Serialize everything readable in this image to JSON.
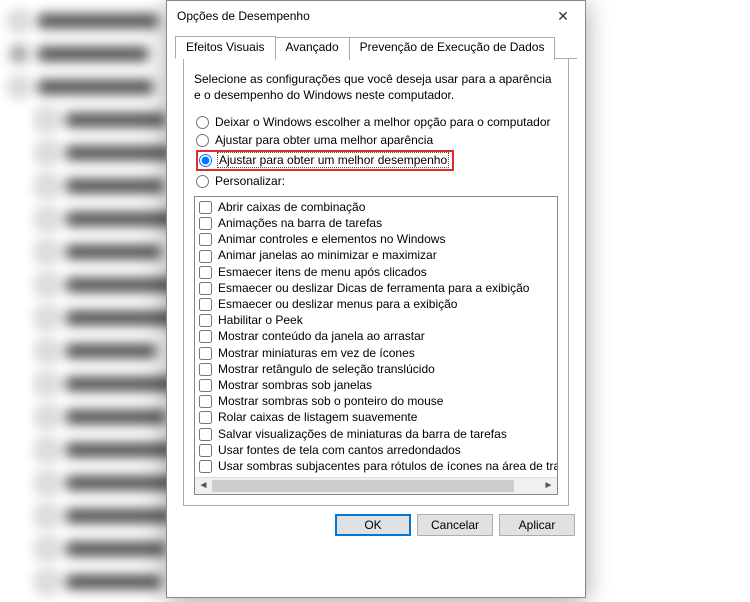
{
  "bg_rows": [
    {
      "kind": "radio",
      "sel": false,
      "w": 120
    },
    {
      "kind": "radio",
      "sel": true,
      "w": 110
    },
    {
      "kind": "radio",
      "sel": false,
      "w": 115
    },
    {
      "kind": "check",
      "sel": false,
      "w": 100,
      "indent": true
    },
    {
      "kind": "check",
      "sel": false,
      "w": 105,
      "indent": true
    },
    {
      "kind": "check",
      "sel": false,
      "w": 98,
      "indent": true
    },
    {
      "kind": "check",
      "sel": false,
      "w": 110,
      "indent": true
    },
    {
      "kind": "check",
      "sel": false,
      "w": 95,
      "indent": true
    },
    {
      "kind": "check",
      "sel": false,
      "w": 120,
      "indent": true
    },
    {
      "kind": "check",
      "sel": false,
      "w": 130,
      "indent": true
    },
    {
      "kind": "check",
      "sel": false,
      "w": 90,
      "indent": true
    },
    {
      "kind": "check",
      "sel": false,
      "w": 140,
      "indent": true
    },
    {
      "kind": "check",
      "sel": false,
      "w": 100,
      "indent": true
    },
    {
      "kind": "check",
      "sel": false,
      "w": 110,
      "indent": true
    },
    {
      "kind": "check",
      "sel": false,
      "w": 115,
      "indent": true
    },
    {
      "kind": "check",
      "sel": false,
      "w": 105,
      "indent": true
    },
    {
      "kind": "check",
      "sel": false,
      "w": 100,
      "indent": true
    },
    {
      "kind": "check",
      "sel": false,
      "w": 95,
      "indent": true
    }
  ],
  "dialog": {
    "title": "Opções de Desempenho",
    "tabs": [
      {
        "label": "Efeitos Visuais",
        "active": true
      },
      {
        "label": "Avançado",
        "active": false
      },
      {
        "label": "Prevenção de Execução de Dados",
        "active": false
      }
    ],
    "intro": "Selecione as configurações que você deseja usar para a aparência e o desempenho do Windows neste computador.",
    "radios": [
      {
        "label": "Deixar o Windows escolher a melhor opção para o computador",
        "checked": false,
        "highlight": false
      },
      {
        "label": "Ajustar para obter uma melhor aparência",
        "checked": false,
        "highlight": false
      },
      {
        "label": "Ajustar para obter um melhor desempenho",
        "checked": true,
        "highlight": true
      },
      {
        "label": "Personalizar:",
        "checked": false,
        "highlight": false
      }
    ],
    "checks": [
      "Abrir caixas de combinação",
      "Animações na barra de tarefas",
      "Animar controles e elementos no Windows",
      "Animar janelas ao minimizar e maximizar",
      "Esmaecer itens de menu após clicados",
      "Esmaecer ou deslizar Dicas de ferramenta para a exibição",
      "Esmaecer ou deslizar menus para a exibição",
      "Habilitar o Peek",
      "Mostrar conteúdo da janela ao arrastar",
      "Mostrar miniaturas em vez de ícones",
      "Mostrar retângulo de seleção translúcido",
      "Mostrar sombras sob janelas",
      "Mostrar sombras sob o ponteiro do mouse",
      "Rolar caixas de listagem suavemente",
      "Salvar visualizações de miniaturas da barra de tarefas",
      "Usar fontes de tela com cantos arredondados",
      "Usar sombras subjacentes para rótulos de ícones na área de trabalho"
    ],
    "buttons": {
      "ok": "OK",
      "cancel": "Cancelar",
      "apply": "Aplicar"
    },
    "scroll": {
      "left": "◄",
      "right": "►"
    }
  }
}
